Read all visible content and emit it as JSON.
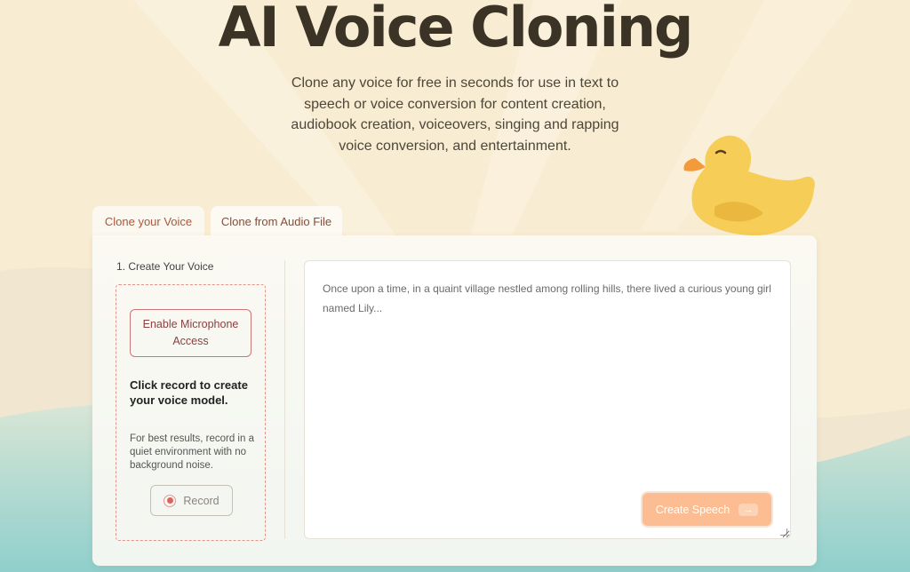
{
  "hero": {
    "title": "AI Voice Cloning",
    "subtitle": "Clone any voice for free in seconds for use in text to speech or voice conversion for content creation, audiobook creation, voiceovers, singing and rapping voice conversion, and entertainment."
  },
  "tabs": [
    {
      "label": "Clone your Voice",
      "active": true
    },
    {
      "label": "Clone from Audio File",
      "active": false
    }
  ],
  "recorder": {
    "step_label": "1. Create Your Voice",
    "mic_button": "Enable Microphone Access",
    "heading": "Click record to create your voice model.",
    "tip": "For best results, record in a quiet environment with no background noise.",
    "record_button": "Record"
  },
  "editor": {
    "placeholder": "Once upon a time, in a quaint village nestled among rolling hills, there lived a curious young girl named Lily...",
    "create_button": "Create Speech"
  },
  "icons": {
    "mascot": "duck-icon",
    "record": "record-dot-icon",
    "create": "arrow-right-icon"
  },
  "colors": {
    "background": "#f8ecd2",
    "accent": "#fbbd91",
    "title": "#3b3426",
    "tab_text": "#b0553c",
    "dashed_border": "#e2938a"
  }
}
